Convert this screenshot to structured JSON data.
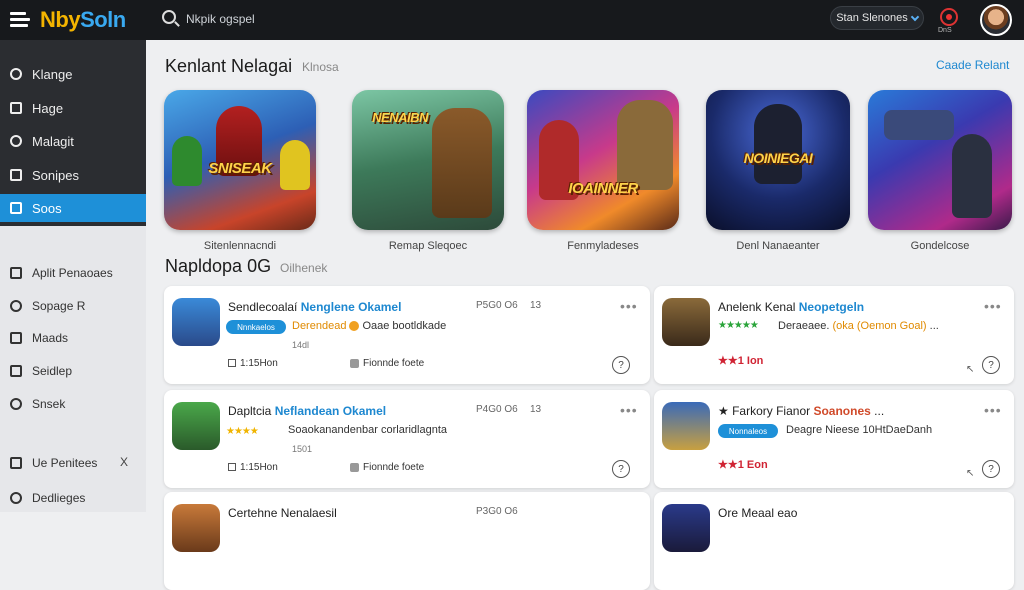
{
  "header": {
    "logo_a": "Nby",
    "logo_b": "Soln",
    "search_placeholder": "Nkpik ogspel",
    "pill_label": "Stan Slenones",
    "rec_label": "DnS"
  },
  "sidebar": {
    "items": [
      {
        "label": "Klange"
      },
      {
        "label": "Hage"
      },
      {
        "label": "Malagit"
      },
      {
        "label": "Sonipes"
      },
      {
        "label": "Soos"
      },
      {
        "label": "Aplit Penaoaes"
      },
      {
        "label": "Sopage R"
      },
      {
        "label": "Maads"
      },
      {
        "label": "Seidlep"
      },
      {
        "label": "Snsek"
      },
      {
        "label": "Ue Penitees"
      },
      {
        "label": "Dedlieges"
      }
    ],
    "extra_icon_label": "X"
  },
  "main": {
    "featured_title": "Kenlant Nelagai",
    "featured_sub": "Klnosa",
    "create_link": "Caade Relant",
    "featured": [
      {
        "banner": "SNISEAK",
        "caption": "Sitenlennacndi"
      },
      {
        "banner": "NENAIBN",
        "caption": "Remap Sleqoec"
      },
      {
        "banner": "IOAINNER",
        "caption": "Fenmyladeses"
      },
      {
        "banner": "NOINIEGAI",
        "caption": "Denl Nanaeanter"
      },
      {
        "banner": "",
        "caption": "Gondelcose"
      }
    ],
    "list_title": "Napldopa 0G",
    "list_sub": "Oilhenek",
    "list_left": [
      {
        "title_a": "Sendlecoalaí",
        "title_b": "Nenglene Okamel",
        "meta": "P5G0 O6",
        "meta2": "13",
        "badge": "Nnnkaelos",
        "desc_a": "Derendead",
        "desc_b": "Oaae bootldkade",
        "num": "14dl",
        "stat1": "1:15Hon",
        "stat2": "Fionnde foete",
        "help": "?"
      },
      {
        "title_a": "Dapltcia",
        "title_b": "Neflandean Okamel",
        "meta": "P4G0 O6",
        "meta2": "13",
        "stars": "★★★★",
        "desc_a": "Soaokanandenbar",
        "desc_b": "corlaridlagnta",
        "num": "1501",
        "stat1": "1:15Hon",
        "stat2": "Fionnde foete",
        "help": "?"
      }
    ],
    "list_right": [
      {
        "title_a": "Anelenk",
        "title_b": "Kenal",
        "title_c": "Neopetgeln",
        "stars": "★★★★★",
        "desc_a": "Deraeaee.",
        "desc_b": "(oka (Oemon Goal)",
        "desc_c": "...",
        "price": "★★1 Ion",
        "help": "?"
      },
      {
        "title_a": "★ Farkory Fianor",
        "title_b": "Soanones",
        "title_c": "...",
        "badge": "Nonnaleos",
        "desc_a": "Deagre Nieese",
        "desc_b": "10HtDaeDanh",
        "price": "★★1 Eon",
        "help": "?"
      }
    ],
    "third_row_left_title": "Certehne Nenalaesil",
    "third_row_left_meta": "P3G0 O6",
    "third_row_right_title": "Ore Meaal eao"
  },
  "colors": {
    "accent": "#1e90d8",
    "topbar": "#17191c",
    "sidebar_dark": "#2b2d31",
    "price_red": "#d02434"
  }
}
